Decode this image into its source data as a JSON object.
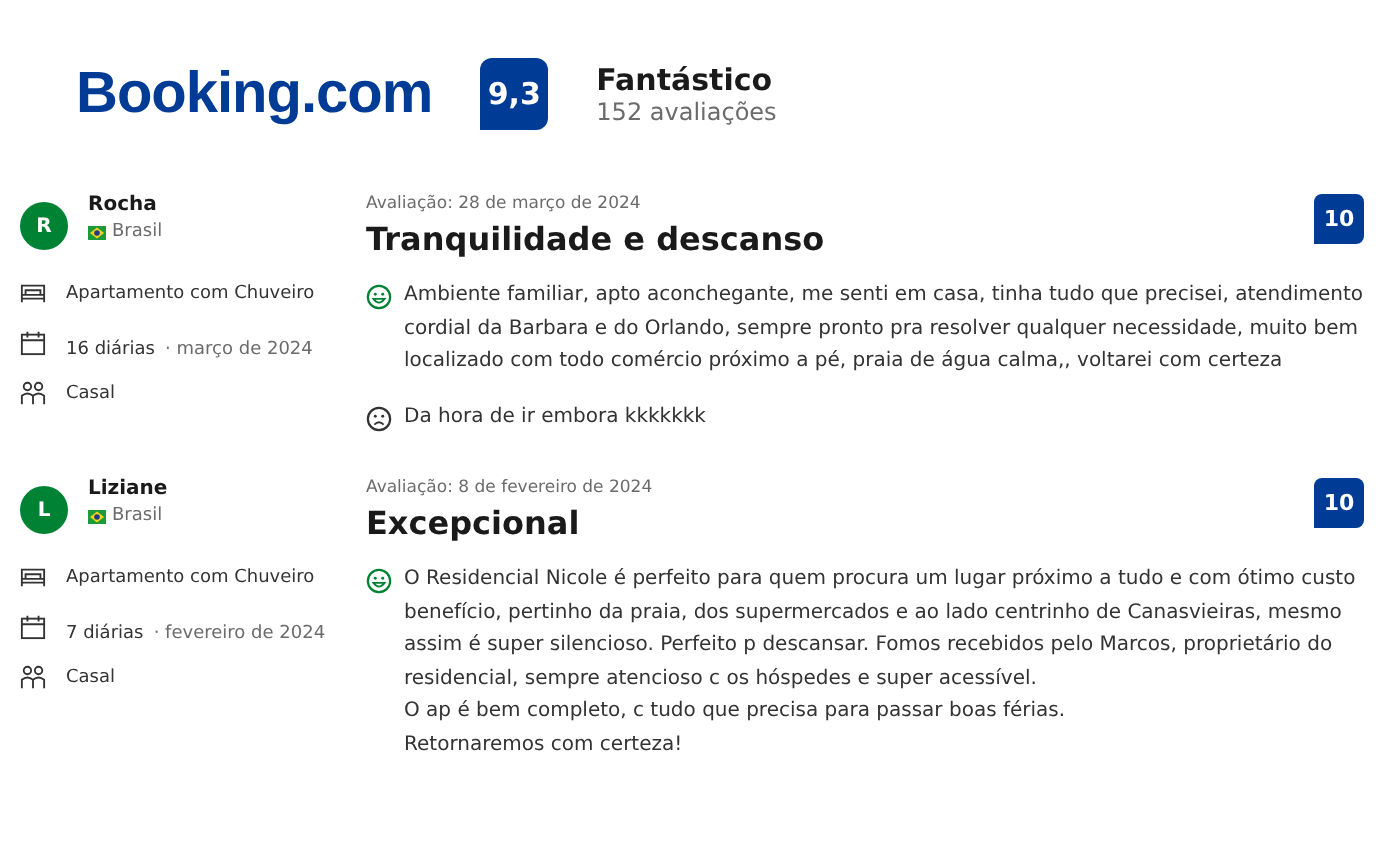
{
  "header": {
    "logo": "Booking.com",
    "score": "9,3",
    "rating": "Fantástico",
    "count": "152 avaliações"
  },
  "reviews": [
    {
      "initial": "R",
      "name": "Rocha",
      "country": "Brasil",
      "room": "Apartamento com Chuveiro",
      "nights": "16 diárias",
      "period": "· março de 2024",
      "party": "Casal",
      "date": "Avaliação: 28 de março de 2024",
      "title": "Tranquilidade e descanso",
      "score": "10",
      "comments": [
        {
          "kind": "positive",
          "text": "Ambiente familiar, apto aconchegante, me senti em casa, tinha tudo que precisei, atendimento cordial da Barbara e do Orlando, sempre pronto pra resolver qualquer necessidade, muito bem localizado com todo comércio próximo a pé, praia de água calma,, voltarei com certeza"
        },
        {
          "kind": "negative",
          "text": "Da hora de ir embora kkkkkkk"
        }
      ]
    },
    {
      "initial": "L",
      "name": "Liziane",
      "country": "Brasil",
      "room": "Apartamento com Chuveiro",
      "nights": "7 diárias",
      "period": "· fevereiro de 2024",
      "party": "Casal",
      "date": "Avaliação: 8 de fevereiro de 2024",
      "title": "Excepcional",
      "score": "10",
      "comments": [
        {
          "kind": "positive",
          "text": "O Residencial Nicole é perfeito para quem procura um lugar próximo a tudo e com ótimo custo benefício, pertinho da praia, dos supermercados e ao lado centrinho de Canasvieiras, mesmo assim é super silencioso. Perfeito p descansar. Fomos recebidos pelo Marcos, proprietário do residencial, sempre atencioso c os hóspedes e super acessível.\nO ap é bem completo, c tudo que precisa para passar boas férias.\nRetornaremos com certeza!"
        }
      ]
    }
  ]
}
